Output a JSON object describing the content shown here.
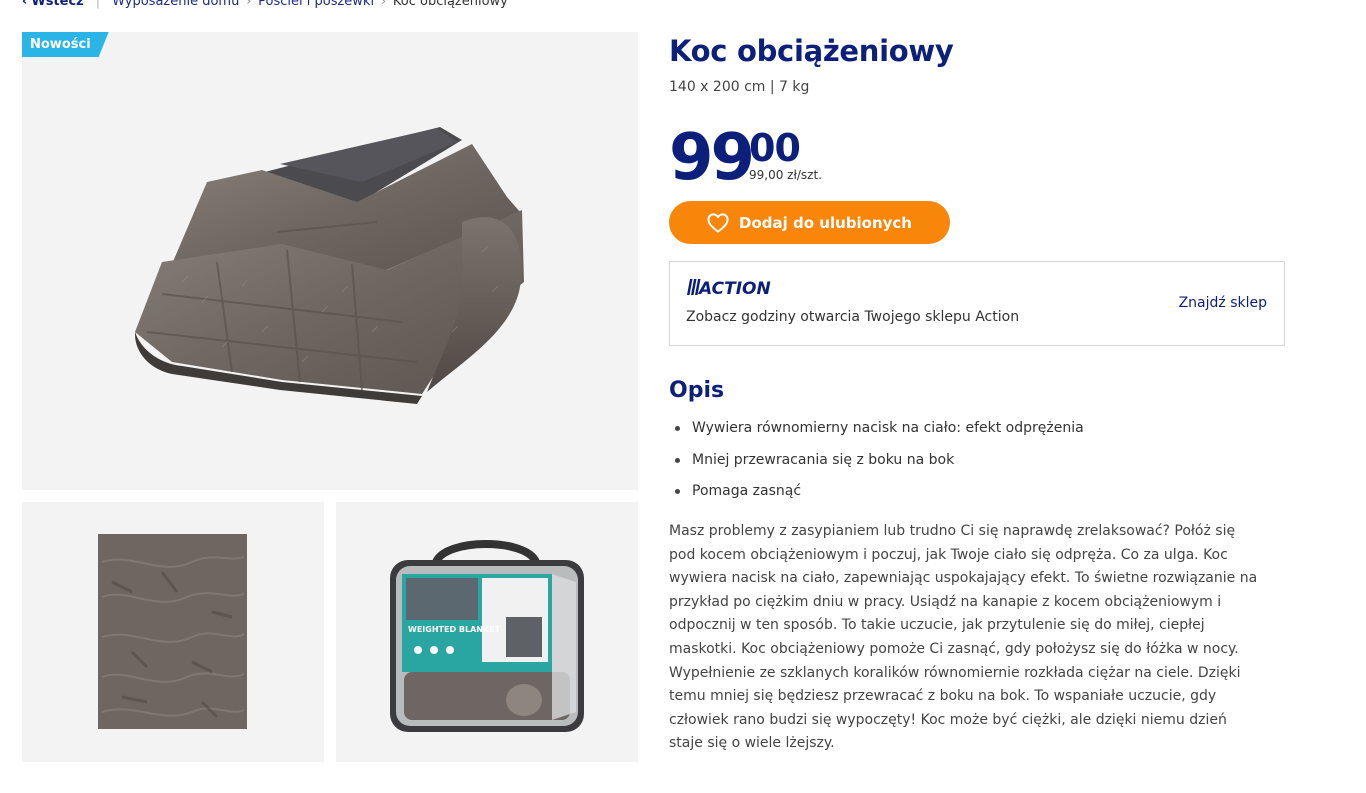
{
  "breadcrumb": {
    "back_label": "Wstecz",
    "items": [
      "Wyposażenie domu",
      "Pościel i poszewki",
      "Koc obciążeniowy"
    ]
  },
  "gallery": {
    "badge": "Nowości",
    "thumb_bag_label": "WEIGHTED BLANKET"
  },
  "product": {
    "title": "Koc obciążeniowy",
    "subtitle": "140 x 200 cm | 7 kg",
    "price_int": "99",
    "price_dec": "00",
    "price_unit": "99,00 zł/szt.",
    "fav_label": "Dodaj do ulubionych"
  },
  "store": {
    "logo_text": "ACTION",
    "text": "Zobacz godziny otwarcia Twojego sklepu Action",
    "link": "Znajdź sklep"
  },
  "description": {
    "title": "Opis",
    "bullets": [
      "Wywiera równomierny nacisk na ciało: efekt odprężenia",
      "Mniej przewracania się z boku na bok",
      "Pomaga zasnąć"
    ],
    "text": "Masz problemy z zasypianiem lub trudno Ci się naprawdę zrelaksować? Połóż się pod kocem obciążeniowym i poczuj, jak Twoje ciało się odpręża. Co za ulga. Koc wywiera nacisk na ciało, zapewniając uspokajający efekt. To świetne rozwiązanie na przykład po ciężkim dniu w pracy. Usiądź na kanapie z kocem obciążeniowym i odpocznij w ten sposób. To takie uczucie, jak przytulenie się do miłej, ciepłej maskotki. Koc obciążeniowy pomoże Ci zasnąć, gdy położysz się do łóżka w nocy. Wypełnienie ze szklanych koralików równomiernie rozkłada ciężar na ciele. Dzięki temu mniej się będziesz przewracać z boku na bok. To wspaniałe uczucie, gdy człowiek rano budzi się wypoczęty! Koc może być ciężki, ale dzięki niemu dzień staje się o wiele lżejszy."
  },
  "colors": {
    "brand_blue": "#0c1f7a",
    "accent_orange": "#f7860b",
    "badge_blue": "#2bb5e6"
  }
}
